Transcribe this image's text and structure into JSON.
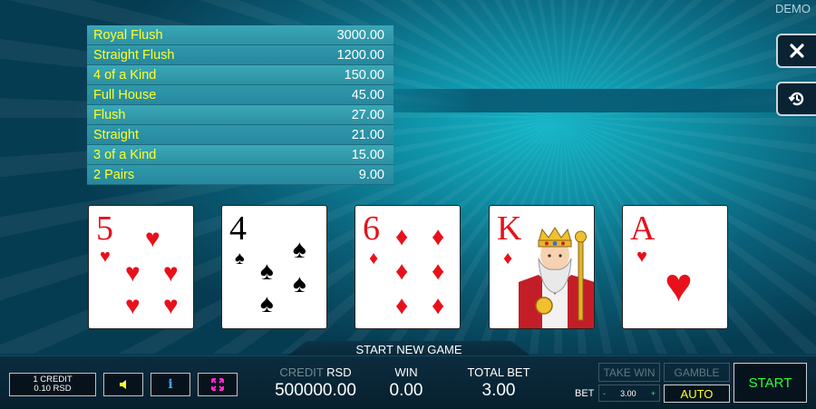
{
  "header": {
    "mode_label": "DEMO"
  },
  "paytable": [
    {
      "hand": "Royal Flush",
      "pay": "3000.00"
    },
    {
      "hand": "Straight Flush",
      "pay": "1200.00"
    },
    {
      "hand": "4 of a Kind",
      "pay": "150.00"
    },
    {
      "hand": "Full House",
      "pay": "45.00"
    },
    {
      "hand": "Flush",
      "pay": "27.00"
    },
    {
      "hand": "Straight",
      "pay": "21.00"
    },
    {
      "hand": "3 of a Kind",
      "pay": "15.00"
    },
    {
      "hand": "2 Pairs",
      "pay": "9.00"
    }
  ],
  "side_buttons": {
    "close_icon": "close-icon",
    "history_icon": "history-icon"
  },
  "cards": [
    {
      "rank": "5",
      "suit": "hearts",
      "color": "#e8111b"
    },
    {
      "rank": "4",
      "suit": "spades",
      "color": "#000000"
    },
    {
      "rank": "6",
      "suit": "diamonds",
      "color": "#e8111b"
    },
    {
      "rank": "K",
      "suit": "diamonds",
      "color": "#e8111b"
    },
    {
      "rank": "A",
      "suit": "hearts",
      "color": "#e8111b"
    }
  ],
  "start_new_game": "START NEW GAME",
  "bottom": {
    "credit_denom_line1": "1 CREDIT",
    "credit_denom_line2": "0.10 RSD",
    "sound_icon": "speaker-icon",
    "info_icon": "info-icon",
    "fullscreen_icon": "fullscreen-icon",
    "credit_label": "CREDIT",
    "credit_currency": "RSD",
    "credit_value": "500000.00",
    "win_label": "WIN",
    "win_value": "0.00",
    "total_bet_label": "TOTAL BET",
    "total_bet_value": "3.00",
    "take_win": "TAKE WIN",
    "gamble": "GAMBLE",
    "bet_label": "BET",
    "bet_minus": "-",
    "bet_value": "3.00",
    "bet_plus": "+",
    "auto": "AUTO",
    "start": "START"
  },
  "colors": {
    "paytable_hand": "#ffff2a",
    "start_text": "#2dff3a",
    "auto_text": "#ffff2a"
  }
}
